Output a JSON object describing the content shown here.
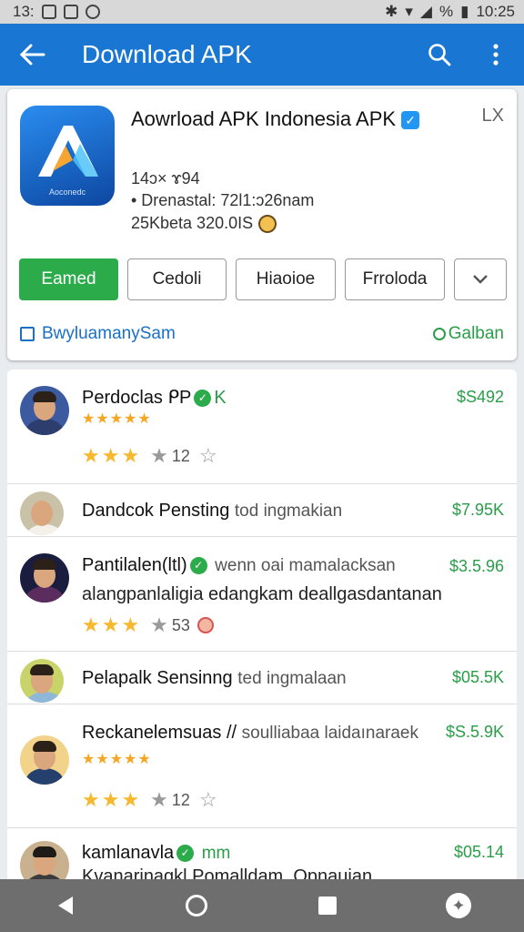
{
  "status_bar": {
    "time_left": "13:",
    "time_right": "10:25",
    "battery": "%"
  },
  "app_bar": {
    "title": "Download APK",
    "back_icon": "arrow-left-icon",
    "search_icon": "search-icon",
    "menu_icon": "more-vert-icon"
  },
  "app_card": {
    "name": "Aowrload APK Indonesia APK",
    "icon_brand": "Aoconedc",
    "close": "LX",
    "meta_size": "14ɔ× ɤ94",
    "meta_date": "• Drenastal: 72l1:ɔ26nam",
    "meta_version": "25Kbeta 320.0IS",
    "buttons": {
      "primary": "Eamed",
      "b2": "Cedoli",
      "b3": "Hiaoioe",
      "b4": "Frroloda",
      "more": "⌄"
    },
    "footer_left": "BwyluamanySam",
    "footer_right": "Galban"
  },
  "reviews": [
    {
      "name": "Perdoclas ᑭP",
      "suffix": "K",
      "price": "$S492",
      "stars_top": "★★★★★",
      "rating_gold": "★★★",
      "rating_count": "12"
    },
    {
      "name": "Dandcok Pensting",
      "sub": "tod ingmakian",
      "price": "$7.95K"
    },
    {
      "name": "Pantilalen(ltl)",
      "sub": "wenn oai mamalacksan",
      "line2": "alangpanlaligia edangkam deallgasdantanan",
      "price": "$3.5.96",
      "rating_gold": "★★★",
      "rating_count": "53"
    },
    {
      "name": "Pelapalk Sensinng",
      "sub": "ted ingmalaan",
      "price": "$05.5K"
    },
    {
      "name": "Reckanelemsuas //",
      "sub": "soulliabaa laidaınaraek",
      "price": "$S.5.9K",
      "stars_top": "★★★★★",
      "rating_gold": "★★★",
      "rating_count": "12"
    },
    {
      "name": "kamlanavla",
      "sub": "mm",
      "line2": "Kvanarinagkl Pomalldam. Opnauian",
      "price": "$05.14"
    }
  ],
  "nav": {
    "back": "back-icon",
    "home": "home-icon",
    "recents": "recents-icon",
    "accessibility": "accessibility-icon"
  }
}
